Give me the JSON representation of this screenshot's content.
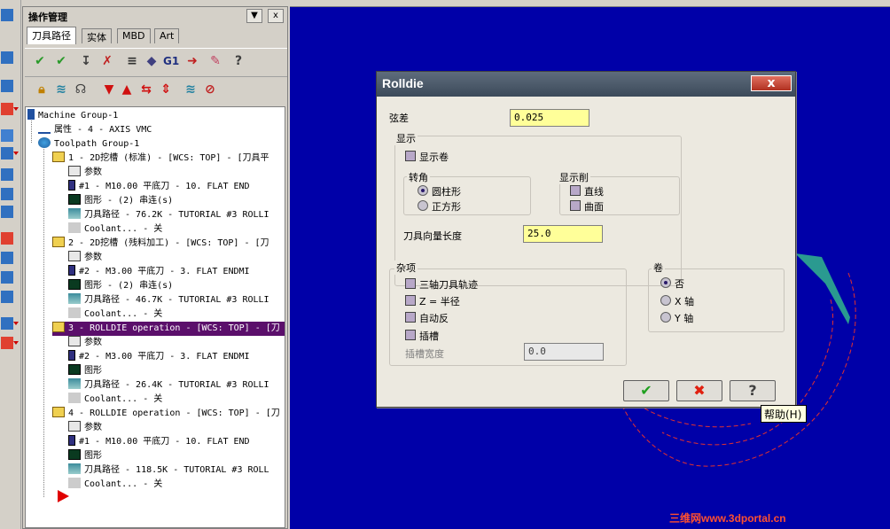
{
  "ops": {
    "title": "操作管理",
    "pin_btn": "▼",
    "close_btn": "x",
    "tabs": [
      "刀具路径",
      "实体",
      "MBD",
      "Art"
    ],
    "tb_g1": "G1",
    "tb_help": "?"
  },
  "tree": {
    "machine": "Machine Group-1",
    "props": "属性 - 4 - AXIS VMC",
    "group": "Toolpath Group-1",
    "ops": [
      {
        "title": "1 - 2D挖槽 (标准) - [WCS: TOP] - [刀具平",
        "param": "参数",
        "tool": "#1 - M10.00 平底刀 -    10. FLAT END",
        "geo": "图形 - (2) 串连(s)",
        "path": "刀具路径 - 76.2K - TUTORIAL #3 ROLLI",
        "cool": "Coolant... - 关"
      },
      {
        "title": "2 - 2D挖槽 (残料加工) - [WCS: TOP] - [刀",
        "param": "参数",
        "tool": "#2 - M3.00 平底刀 -    3. FLAT ENDMI",
        "geo": "图形 - (2) 串连(s)",
        "path": "刀具路径 - 46.7K - TUTORIAL #3 ROLLI",
        "cool": "Coolant... - 关"
      },
      {
        "title": "3 - ROLLDIE operation - [WCS: TOP] - [刀",
        "param": "参数",
        "tool": "#2 - M3.00 平底刀 -    3. FLAT ENDMI",
        "geo": "图形",
        "path": "刀具路径 - 26.4K - TUTORIAL #3 ROLLI",
        "cool": "Coolant... - 关"
      },
      {
        "title": "4 - ROLLDIE operation - [WCS: TOP] - [刀",
        "param": "参数",
        "tool": "#1 - M10.00 平底刀 -    10. FLAT END",
        "geo": "图形",
        "path": "刀具路径 - 118.5K - TUTORIAL #3 ROLL",
        "cool": "Coolant... - 关"
      }
    ]
  },
  "dialog": {
    "title": "Rolldie",
    "close": "x",
    "chord_label": "弦差",
    "chord_value": "0.025",
    "display_label": "显示",
    "show_roll_label": "显示卷",
    "corner_label": "转角",
    "corner_options": [
      "圆柱形",
      "正方形"
    ],
    "corner_selected": 0,
    "display_cut_label": "显示削",
    "display_cut_options": [
      "直线",
      "曲面"
    ],
    "tool_vec_label": "刀具向量长度",
    "tool_vec_value": "25.0",
    "misc_label": "杂项",
    "misc_options": [
      "三轴刀具轨迹",
      "Z = 半径",
      "自动反",
      "插槽"
    ],
    "slot_width_label": "插槽宽度",
    "slot_width_value": "0.0",
    "roll_label": "卷",
    "roll_options": [
      "否",
      "X 轴",
      "Y 轴"
    ],
    "roll_selected": 0,
    "ok": "✔",
    "cancel": "✖",
    "help": "?"
  },
  "tooltip": "帮助(H)",
  "watermark": "三维网www.3dportal.cn"
}
